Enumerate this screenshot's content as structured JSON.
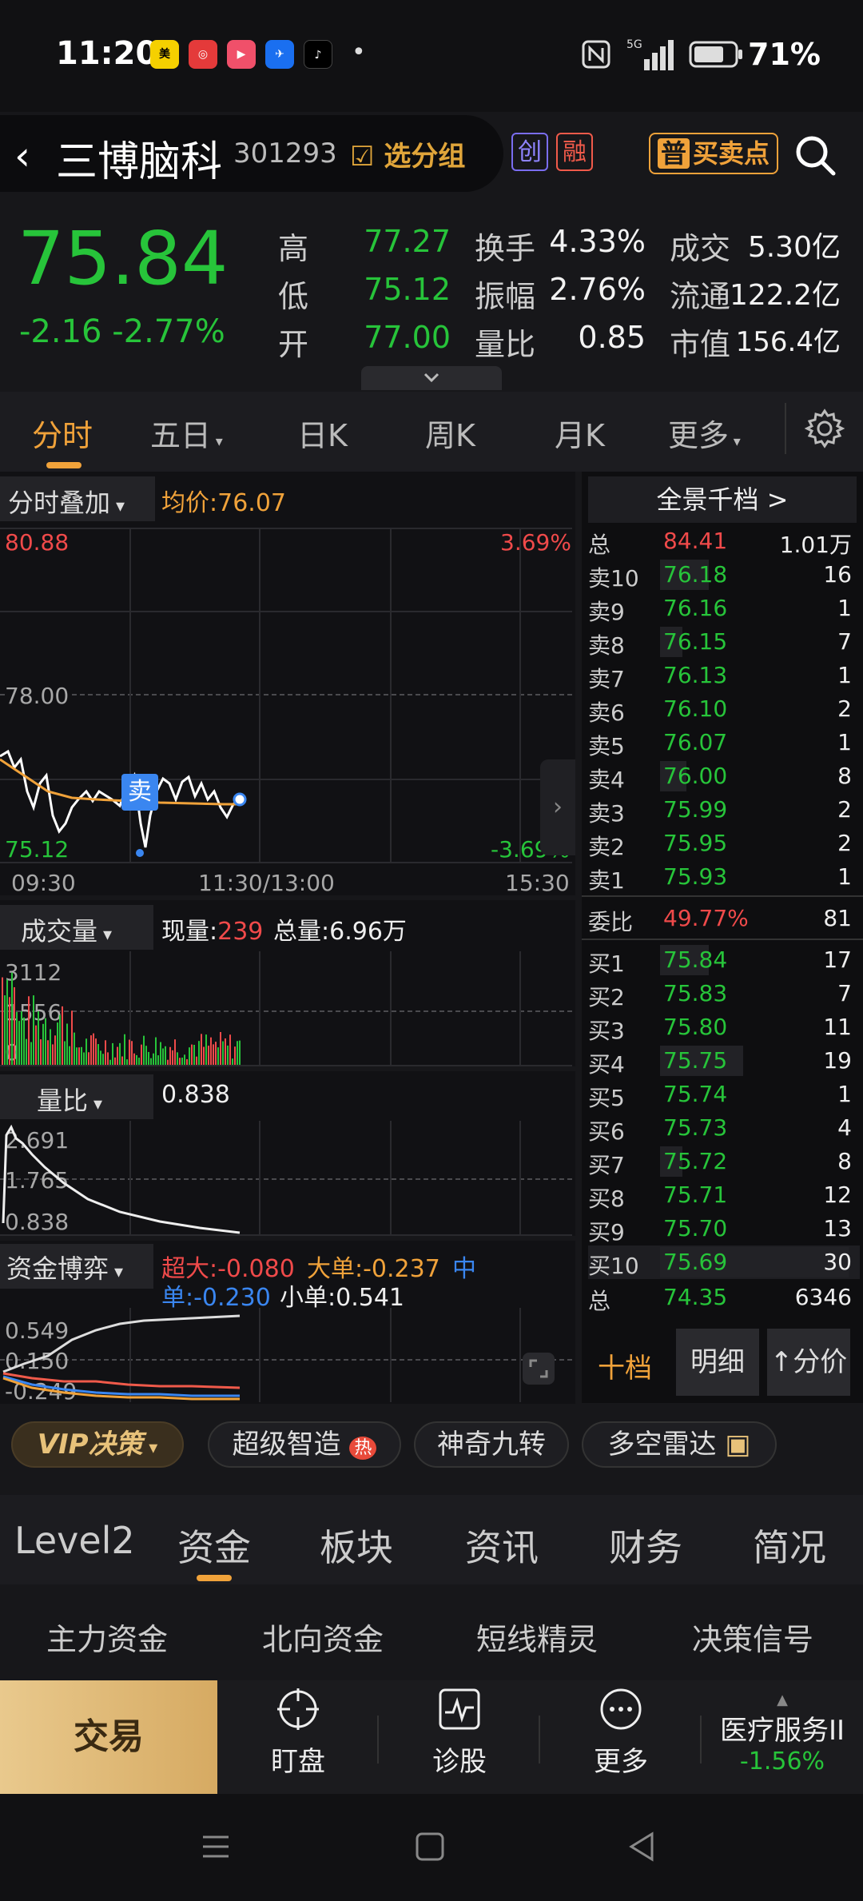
{
  "status": {
    "time": "11:20",
    "network": "5G",
    "battery": "71%"
  },
  "header": {
    "stock_name": "三博脑科",
    "stock_code": "301293",
    "watch_label": "选分组",
    "tag_chuang": "创",
    "tag_rong": "融",
    "buysell_badge": "普",
    "buysell_label": "买卖点"
  },
  "quote": {
    "price": "75.84",
    "change": "-2.16 -2.77%",
    "high_label": "高",
    "high": "77.27",
    "low_label": "低",
    "low": "75.12",
    "open_label": "开",
    "open": "77.00",
    "turnover_label": "换手",
    "turnover": "4.33%",
    "amplitude_label": "振幅",
    "amplitude": "2.76%",
    "volratio_label": "量比",
    "volratio": "0.85",
    "amount_label": "成交",
    "amount": "5.30亿",
    "float_label": "流通",
    "float": "122.2亿",
    "mktcap_label": "市值",
    "mktcap": "156.4亿"
  },
  "ktabs": [
    "分时",
    "五日",
    "日K",
    "周K",
    "月K",
    "更多"
  ],
  "intraday": {
    "overlay_label": "分时叠加",
    "avg_label": "均价:76.07",
    "top_price": "80.88",
    "top_pct": "3.69%",
    "mid_price": "78.00",
    "bottom_price": "75.12",
    "bottom_pct": "-3.69%",
    "sell_marker": "卖",
    "times": [
      "09:30",
      "11:30/13:00",
      "15:30"
    ]
  },
  "volume_panel": {
    "label": "成交量",
    "current_label": "现量:",
    "current": "239",
    "total": "总量:6.96万",
    "max": "3112",
    "mid": "1556",
    "min": "0"
  },
  "ratio_panel": {
    "label": "量比",
    "value": "0.838",
    "max": "2.691",
    "mid": "1.765",
    "min": "0.838"
  },
  "fund_panel": {
    "label": "资金博弈",
    "super": "超大:-0.080",
    "large": "大单:-0.237",
    "mid_a": "中",
    "mid_b": "单:-0.230",
    "small": "小单:0.541",
    "max": "0.549",
    "mid": "0.150",
    "min": "-0.249"
  },
  "orderbook": {
    "title": "全景千档 >",
    "total_sell": {
      "label": "总",
      "price": "84.41",
      "vol": "1.01万"
    },
    "sells": [
      {
        "label": "卖10",
        "price": "76.18",
        "vol": "16",
        "bar": 0.26
      },
      {
        "label": "卖9",
        "price": "76.16",
        "vol": "1",
        "bar": 0.0
      },
      {
        "label": "卖8",
        "price": "76.15",
        "vol": "7",
        "bar": 0.12
      },
      {
        "label": "卖7",
        "price": "76.13",
        "vol": "1",
        "bar": 0.0
      },
      {
        "label": "卖6",
        "price": "76.10",
        "vol": "2",
        "bar": 0.0
      },
      {
        "label": "卖5",
        "price": "76.07",
        "vol": "1",
        "bar": 0.0
      },
      {
        "label": "卖4",
        "price": "76.00",
        "vol": "8",
        "bar": 0.14
      },
      {
        "label": "卖3",
        "price": "75.99",
        "vol": "2",
        "bar": 0.0
      },
      {
        "label": "卖2",
        "price": "75.95",
        "vol": "2",
        "bar": 0.0
      },
      {
        "label": "卖1",
        "price": "75.93",
        "vol": "1",
        "bar": 0.0
      }
    ],
    "ratio": {
      "label": "委比",
      "pct": "49.77%",
      "vol": "81"
    },
    "buys": [
      {
        "label": "买1",
        "price": "75.84",
        "vol": "17",
        "bar": 0.26
      },
      {
        "label": "买2",
        "price": "75.83",
        "vol": "7",
        "bar": 0.0
      },
      {
        "label": "买3",
        "price": "75.80",
        "vol": "11",
        "bar": 0.0
      },
      {
        "label": "买4",
        "price": "75.75",
        "vol": "19",
        "bar": 0.44
      },
      {
        "label": "买5",
        "price": "75.74",
        "vol": "1",
        "bar": 0.0
      },
      {
        "label": "买6",
        "price": "75.73",
        "vol": "4",
        "bar": 0.0
      },
      {
        "label": "买7",
        "price": "75.72",
        "vol": "8",
        "bar": 0.12
      },
      {
        "label": "买8",
        "price": "75.71",
        "vol": "12",
        "bar": 0.0
      },
      {
        "label": "买9",
        "price": "75.70",
        "vol": "13",
        "bar": 0.0
      },
      {
        "label": "买10",
        "price": "75.69",
        "vol": "30",
        "bar": 1.0
      }
    ],
    "total_buy": {
      "label": "总",
      "price": "74.35",
      "vol": "6346"
    },
    "btn_ten": "十档",
    "btn_detail": "明细",
    "btn_split": "分价"
  },
  "vip_row": {
    "vip": "VIP决策",
    "p1": "超级智造",
    "hot": "热",
    "p2": "神奇九转",
    "p3": "多空雷达"
  },
  "bottom_tabs": [
    "Level2",
    "资金",
    "板块",
    "资讯",
    "财务",
    "简况"
  ],
  "sub_tabs": [
    "主力资金",
    "北向资金",
    "短线精灵",
    "决策信号"
  ],
  "tradebar": {
    "trade": "交易",
    "watch": "盯盘",
    "diag": "诊股",
    "more": "更多",
    "sector_name": "医疗服务II",
    "sector_change": "-1.56%"
  },
  "colors": {
    "up": "#f04a4a",
    "down": "#27c43a",
    "accent": "#f0a23a"
  }
}
